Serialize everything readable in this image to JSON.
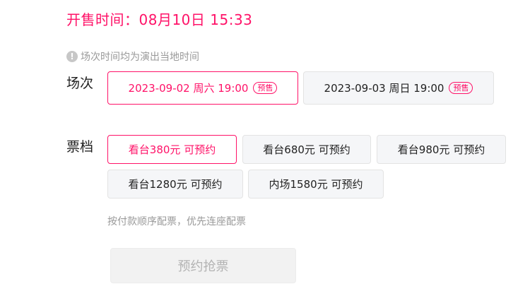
{
  "sale": {
    "text": "开售时间：08月10日 15:33"
  },
  "tip": {
    "icon": "info-icon",
    "text": "场次时间均为演出当地时间"
  },
  "sessions": {
    "label": "场次",
    "items": [
      {
        "date": "2023-09-02 周六 19:00",
        "badge": "预售",
        "selected": true
      },
      {
        "date": "2023-09-03 周日 19:00",
        "badge": "预售",
        "selected": false
      }
    ]
  },
  "prices": {
    "label": "票档",
    "items": [
      {
        "label": "看台380元 可预约",
        "selected": true
      },
      {
        "label": "看台680元 可预约",
        "selected": false
      },
      {
        "label": "看台980元 可预约",
        "selected": false
      },
      {
        "label": "看台1280元 可预约",
        "selected": false
      },
      {
        "label": "内场1580元 可预约",
        "selected": false
      }
    ]
  },
  "note": "按付款顺序配票，优先连座配票",
  "reserve": {
    "label": "预约抢票",
    "enabled": false
  },
  "colors": {
    "accent": "#ff1268",
    "muted": "#999999",
    "button_bg": "#f5f6f8"
  }
}
